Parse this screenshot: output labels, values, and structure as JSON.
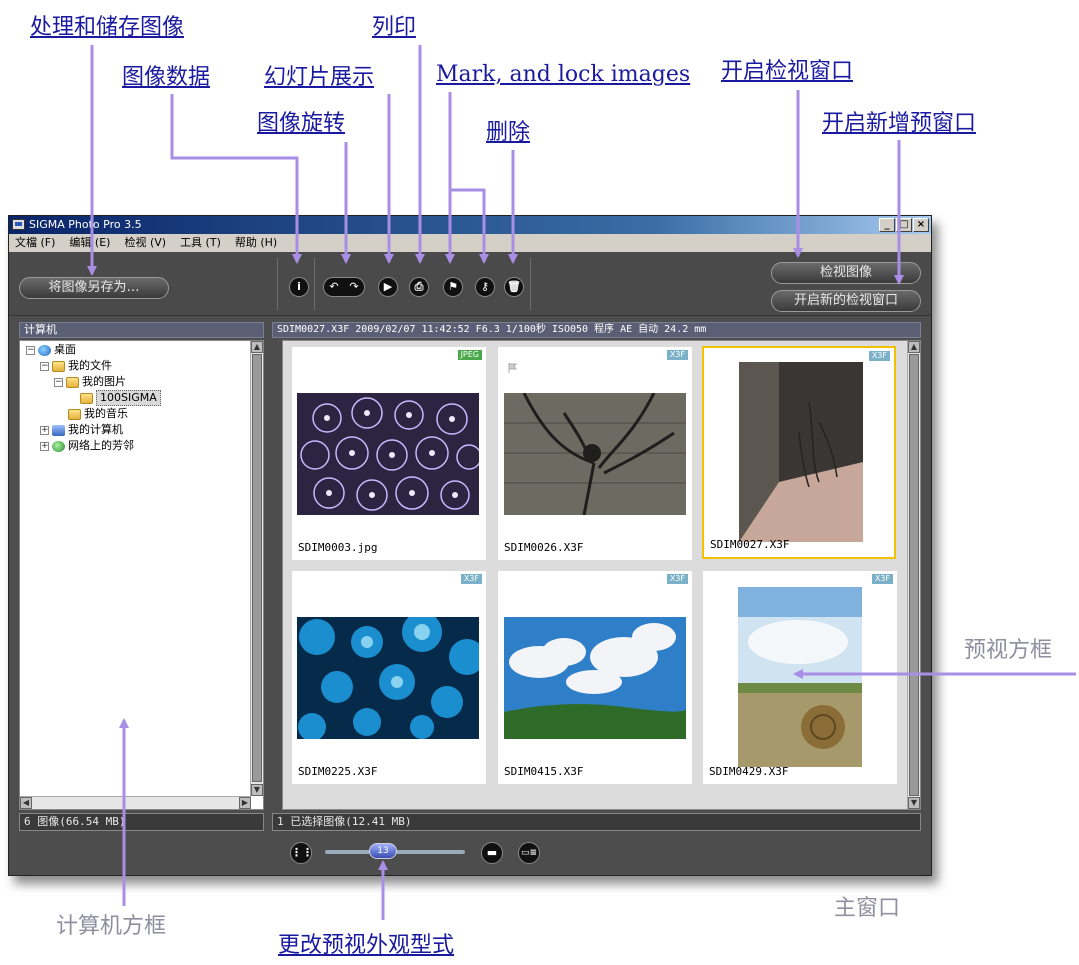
{
  "window": {
    "title": "SIGMA Photo Pro 3.5",
    "controls": [
      "_",
      "□",
      "×"
    ]
  },
  "menu": [
    "文檔 (F)",
    "编辑 (E)",
    "检视 (V)",
    "工具 (T)",
    "帮助 (H)"
  ],
  "toolbar": {
    "save_as": "将图像另存为…",
    "info": "i",
    "rotate_left": "↶",
    "rotate_right": "↷",
    "slideshow": "▶",
    "print": "⎙",
    "mark": "⚑",
    "lock": "⚷",
    "delete": "🗑",
    "view_image": "检视图像",
    "open_new_view": "开启新的检视窗口"
  },
  "left_panel": {
    "title": "计算机",
    "tree": [
      {
        "label": "桌面",
        "icon": "globe-icon",
        "expander": "−"
      },
      {
        "label": "我的文件",
        "icon": "folder-icon",
        "expander": "−"
      },
      {
        "label": "我的图片",
        "icon": "folder-icon",
        "expander": "−"
      },
      {
        "label": "100SIGMA",
        "icon": "folder-icon",
        "expander": ""
      },
      {
        "label": "我的音乐",
        "icon": "folder-icon",
        "expander": ""
      },
      {
        "label": "我的计算机",
        "icon": "computer-icon",
        "expander": "+"
      },
      {
        "label": "网络上的芳邻",
        "icon": "network-icon",
        "expander": "+"
      }
    ],
    "status": "6 图像(66.54 MB)"
  },
  "preview_panel": {
    "info_bar": "SDIM0027.X3F 2009/02/07 11:42:52 F6.3 1/100秒 ISO050 程序 AE  自动 24.2 mm",
    "status": "1 已选择图像(12.41 MB)",
    "thumbnails": [
      {
        "filename": "SDIM0003.jpg",
        "badge": "JPEG",
        "selected": false,
        "flagged": false
      },
      {
        "filename": "SDIM0026.X3F",
        "badge": "X3F",
        "selected": false,
        "flagged": true
      },
      {
        "filename": "SDIM0027.X3F",
        "badge": "X3F",
        "selected": true,
        "flagged": false
      },
      {
        "filename": "SDIM0225.X3F",
        "badge": "X3F",
        "selected": false,
        "flagged": false
      },
      {
        "filename": "SDIM0415.X3F",
        "badge": "X3F",
        "selected": false,
        "flagged": false
      },
      {
        "filename": "SDIM0429.X3F",
        "badge": "X3F",
        "selected": false,
        "flagged": false
      }
    ]
  },
  "bottom": {
    "slider_value": "13",
    "grid_icon": "grid-view-icon",
    "single_icon": "single-view-icon",
    "list_icon": "list-view-icon"
  },
  "callouts": {
    "save_store": "处理和储存图像",
    "image_data": "图像数据",
    "slideshow": "幻灯片展示",
    "print": "列印",
    "mark_lock": "Mark, and lock images",
    "open_viewer": "开启检视窗口",
    "rotate": "图像旋转",
    "delete": "删除",
    "open_new_preview": "开启新增预窗口",
    "preview_frame": "预视方框",
    "computer_frame": "计算机方框",
    "main_window": "主窗口",
    "change_preview": "更改预视外观型式"
  },
  "colors": {
    "callout_link": "#1a1aa0",
    "callout_plain": "#8f8f9f",
    "arrow": "#a98ee6",
    "selection": "#f2c200",
    "badge_x3f": "#7ab0c8",
    "badge_jpeg": "#4aa84a"
  }
}
